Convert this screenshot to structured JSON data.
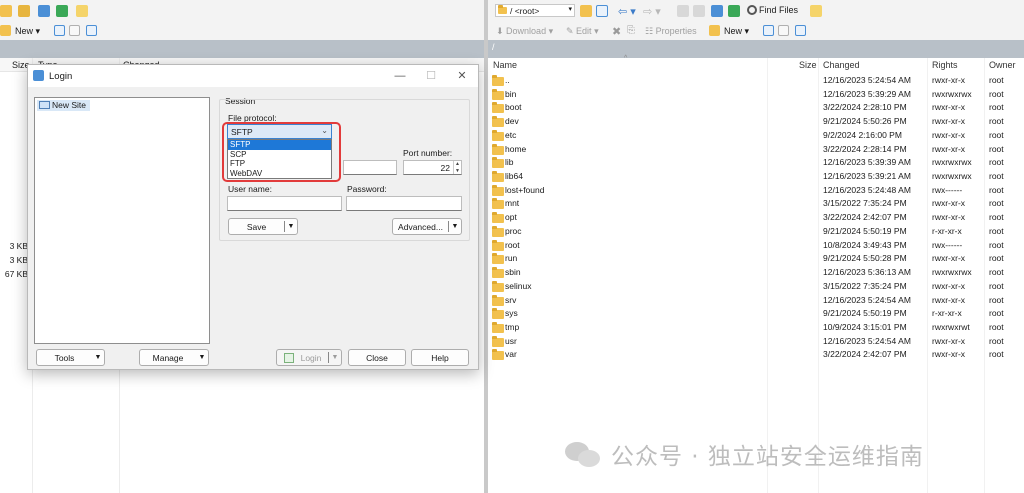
{
  "left_toolbar": {
    "new_label": "New"
  },
  "left_header": {
    "size": "Size",
    "type": "Type",
    "changed": "Changed"
  },
  "left_sizes": [
    "3 KB",
    "3 KB",
    "67 KB"
  ],
  "right_toolbar": {
    "path_combo": "/ <root>",
    "find_files": "Find Files",
    "download": "Download",
    "edit": "Edit",
    "properties": "Properties",
    "new_label": "New"
  },
  "path_bar": "/",
  "columns": {
    "name": "Name",
    "size": "Size",
    "changed": "Changed",
    "rights": "Rights",
    "owner": "Owner"
  },
  "files": [
    {
      "name": "..",
      "changed": "12/16/2023 5:24:54 AM",
      "rights": "rwxr-xr-x",
      "owner": "root"
    },
    {
      "name": "bin",
      "changed": "12/16/2023 5:39:29 AM",
      "rights": "rwxrwxrwx",
      "owner": "root"
    },
    {
      "name": "boot",
      "changed": "3/22/2024 2:28:10 PM",
      "rights": "rwxr-xr-x",
      "owner": "root"
    },
    {
      "name": "dev",
      "changed": "9/21/2024 5:50:26 PM",
      "rights": "rwxr-xr-x",
      "owner": "root"
    },
    {
      "name": "etc",
      "changed": "9/2/2024 2:16:00 PM",
      "rights": "rwxr-xr-x",
      "owner": "root"
    },
    {
      "name": "home",
      "changed": "3/22/2024 2:28:14 PM",
      "rights": "rwxr-xr-x",
      "owner": "root"
    },
    {
      "name": "lib",
      "changed": "12/16/2023 5:39:39 AM",
      "rights": "rwxrwxrwx",
      "owner": "root"
    },
    {
      "name": "lib64",
      "changed": "12/16/2023 5:39:21 AM",
      "rights": "rwxrwxrwx",
      "owner": "root"
    },
    {
      "name": "lost+found",
      "changed": "12/16/2023 5:24:48 AM",
      "rights": "rwx------",
      "owner": "root"
    },
    {
      "name": "mnt",
      "changed": "3/15/2022 7:35:24 PM",
      "rights": "rwxr-xr-x",
      "owner": "root"
    },
    {
      "name": "opt",
      "changed": "3/22/2024 2:42:07 PM",
      "rights": "rwxr-xr-x",
      "owner": "root"
    },
    {
      "name": "proc",
      "changed": "9/21/2024 5:50:19 PM",
      "rights": "r-xr-xr-x",
      "owner": "root"
    },
    {
      "name": "root",
      "changed": "10/8/2024 3:49:43 PM",
      "rights": "rwx------",
      "owner": "root"
    },
    {
      "name": "run",
      "changed": "9/21/2024 5:50:28 PM",
      "rights": "rwxr-xr-x",
      "owner": "root"
    },
    {
      "name": "sbin",
      "changed": "12/16/2023 5:36:13 AM",
      "rights": "rwxrwxrwx",
      "owner": "root"
    },
    {
      "name": "selinux",
      "changed": "3/15/2022 7:35:24 PM",
      "rights": "rwxr-xr-x",
      "owner": "root"
    },
    {
      "name": "srv",
      "changed": "12/16/2023 5:24:54 AM",
      "rights": "rwxr-xr-x",
      "owner": "root"
    },
    {
      "name": "sys",
      "changed": "9/21/2024 5:50:19 PM",
      "rights": "r-xr-xr-x",
      "owner": "root"
    },
    {
      "name": "tmp",
      "changed": "10/9/2024 3:15:01 PM",
      "rights": "rwxrwxrwt",
      "owner": "root"
    },
    {
      "name": "usr",
      "changed": "12/16/2023 5:24:54 AM",
      "rights": "rwxr-xr-x",
      "owner": "root"
    },
    {
      "name": "var",
      "changed": "3/22/2024 2:42:07 PM",
      "rights": "rwxr-xr-x",
      "owner": "root"
    }
  ],
  "login": {
    "title": "Login",
    "minimize": "—",
    "maximize": "☐",
    "close": "✕",
    "site_item": "New Site",
    "session_label": "Session",
    "file_protocol_label": "File protocol:",
    "protocol_selected": "SFTP",
    "protocol_options": [
      "SFTP",
      "SCP",
      "FTP",
      "WebDAV"
    ],
    "port_label": "Port number:",
    "port_value": "22",
    "user_label": "User name:",
    "password_label": "Password:",
    "save_button": "Save",
    "advanced_button": "Advanced...",
    "tools_button": "Tools",
    "manage_button": "Manage",
    "login_button": "Login",
    "close_button": "Close",
    "help_button": "Help"
  },
  "watermark": "公众号 · 独立站安全运维指南",
  "colors": {
    "highlight_red": "#e23b3b",
    "selection_blue": "#1e78d7",
    "folder_yellow": "#f2c14e",
    "path_strip": "#b8c0c8"
  }
}
